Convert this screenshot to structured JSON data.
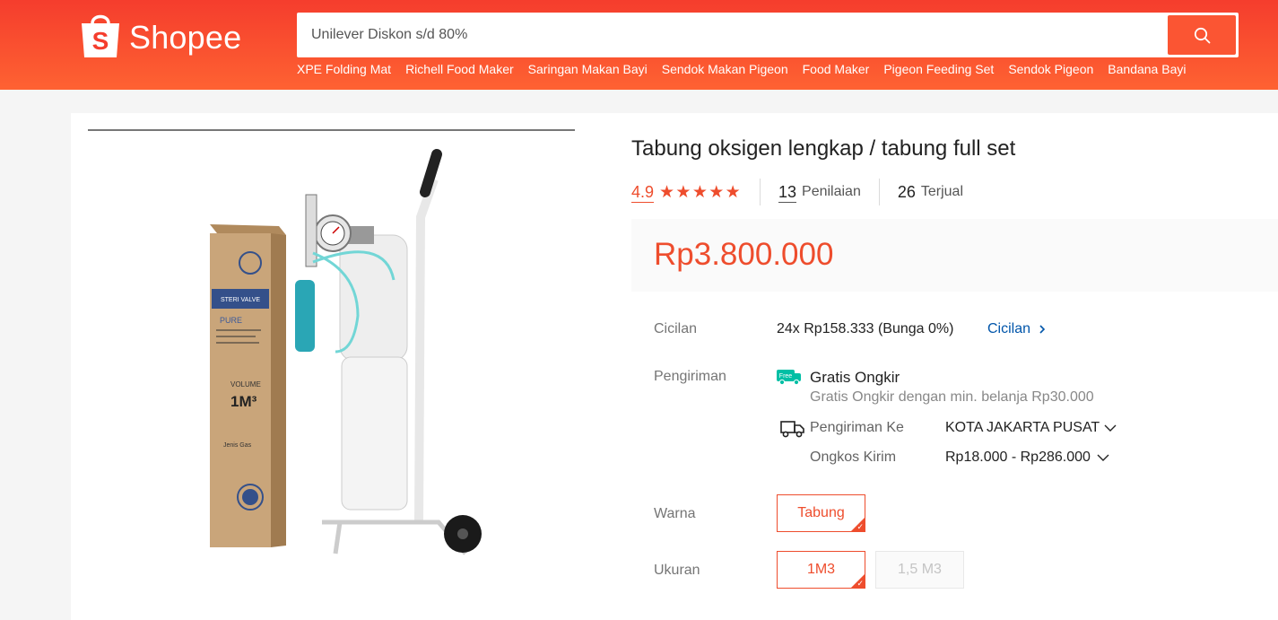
{
  "header": {
    "logo_text": "Shopee",
    "search_placeholder": "Unilever Diskon s/d 80%",
    "suggestions": [
      "XPE Folding Mat",
      "Richell Food Maker",
      "Saringan Makan Bayi",
      "Sendok Makan Pigeon",
      "Food Maker",
      "Pigeon Feeding Set",
      "Sendok Pigeon",
      "Bandana Bayi"
    ]
  },
  "product": {
    "title": "Tabung oksigen lengkap / tabung full set",
    "rating": "4.9",
    "stars": 5,
    "reviews_count": "13",
    "reviews_label": "Penilaian",
    "sold_count": "26",
    "sold_label": "Terjual",
    "price": "Rp3.800.000",
    "image_text": {
      "box_brand": "STERI VALVE",
      "box_pure": "PURE",
      "box_volume_label": "VOLUME",
      "box_volume": "1M³",
      "box_gas": "Jenis Gas"
    }
  },
  "cicilan": {
    "label": "Cicilan",
    "value": "24x Rp158.333 (Bunga 0%)",
    "link": "Cicilan"
  },
  "pengiriman": {
    "label": "Pengiriman",
    "free_badge": "Free",
    "free_title": "Gratis Ongkir",
    "free_desc": "Gratis Ongkir dengan min. belanja Rp30.000",
    "ship_to_label": "Pengiriman Ke",
    "ship_to_value": "KOTA JAKARTA PUSAT",
    "cost_label": "Ongkos Kirim",
    "cost_value": "Rp18.000 - Rp286.000"
  },
  "warna": {
    "label": "Warna",
    "options": [
      "Tabung"
    ]
  },
  "ukuran": {
    "label": "Ukuran",
    "options": [
      "1M3",
      "1,5 M3"
    ]
  },
  "colors": {
    "brand": "#ee4d2d",
    "link": "#0055aa",
    "free_badge": "#00bfa5"
  }
}
